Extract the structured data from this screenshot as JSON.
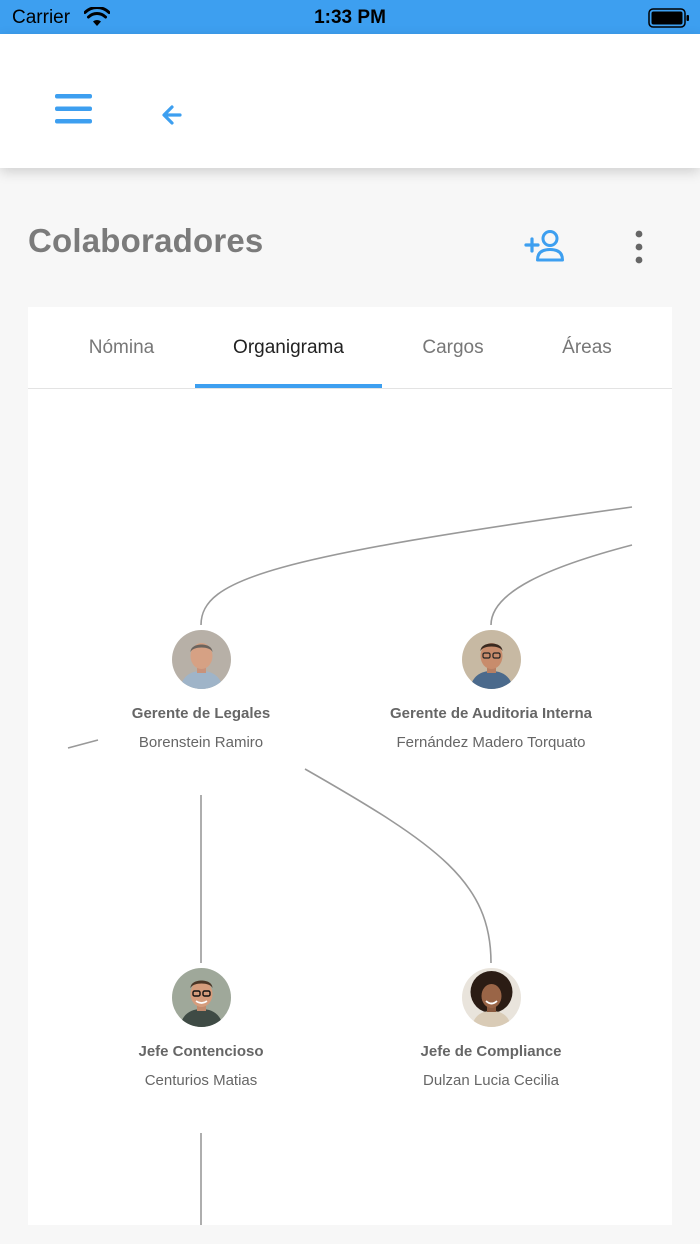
{
  "status_bar": {
    "carrier": "Carrier",
    "time": "1:33 PM"
  },
  "page": {
    "title": "Colaboradores"
  },
  "tabs": [
    {
      "label": "Nómina"
    },
    {
      "label": "Organigrama"
    },
    {
      "label": "Cargos"
    },
    {
      "label": "Áreas"
    }
  ],
  "active_tab": "Organigrama",
  "colors": {
    "accent": "#3d9ff0",
    "title": "#7b7b7b",
    "line": "#999999"
  },
  "org_chart": {
    "nodes": [
      {
        "role": "Gerente de Legales",
        "name": "Borenstein Ramiro"
      },
      {
        "role": "Gerente de Auditoria Interna",
        "name": "Fernández Madero Torquato"
      },
      {
        "role": "Jefe Contencioso",
        "name": "Centurios Matias"
      },
      {
        "role": "Jefe de Compliance",
        "name": "Dulzan Lucia Cecilia"
      }
    ]
  }
}
